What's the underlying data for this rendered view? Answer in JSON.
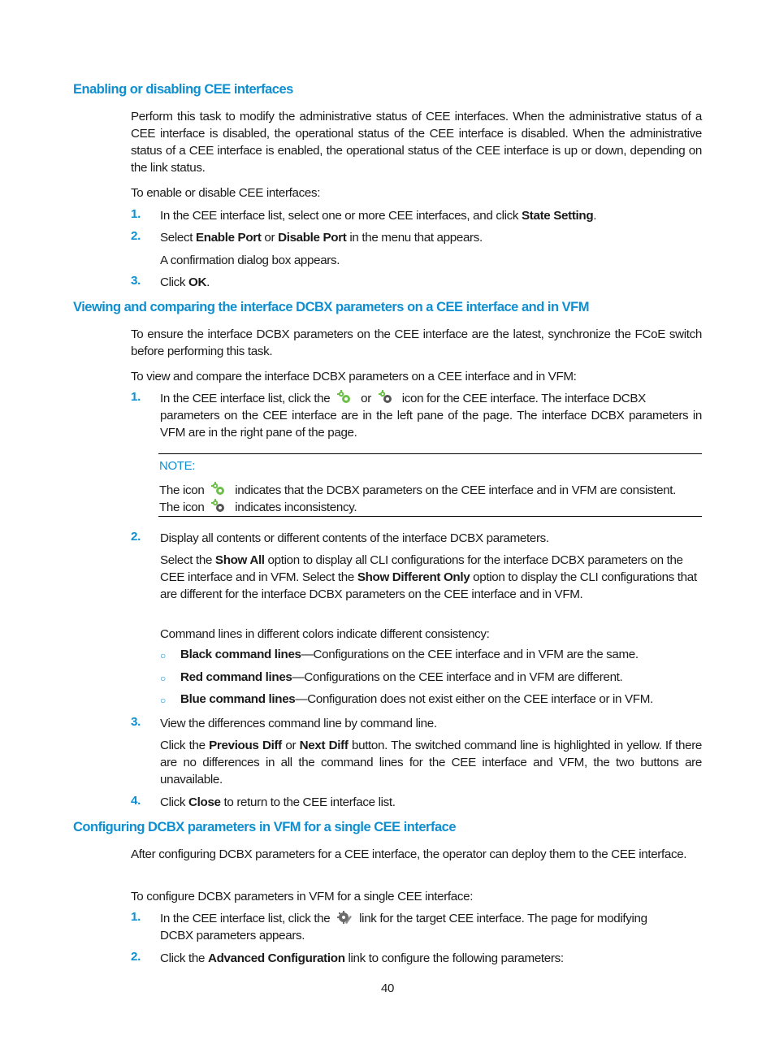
{
  "section1": {
    "heading": "Enabling or disabling CEE interfaces",
    "intro": "Perform this task to modify the administrative status of CEE interfaces. When the administrative status of a CEE interface is disabled, the operational status of the CEE interface is disabled. When the administrative status of a CEE interface is enabled, the operational status of the CEE interface is up or down, depending on the link status.",
    "lead": "To enable or disable CEE interfaces:",
    "steps": [
      {
        "num": "1.",
        "pre": "In the CEE interface list, select one or more CEE interfaces, and click ",
        "bold": "State Setting",
        "post": "."
      },
      {
        "num": "2.",
        "pre": "Select ",
        "bold1": "Enable Port",
        "mid": " or ",
        "bold2": "Disable Port",
        "post": " in the menu that appears.",
        "sub": "A confirmation dialog box appears."
      },
      {
        "num": "3.",
        "pre": "Click ",
        "bold": "OK",
        "post": "."
      }
    ]
  },
  "section2": {
    "heading": "Viewing and comparing the interface DCBX parameters on a CEE interface and in VFM",
    "intro": "To ensure the interface DCBX parameters on the CEE interface are the latest, synchronize the FCoE switch before performing this task.",
    "lead": "To view and compare the interface DCBX parameters on a CEE interface and in VFM:",
    "step1": {
      "num": "1.",
      "pre": "In the CEE interface list, click the",
      "or": "or",
      "post_line1": "icon for the CEE interface. The interface DCBX",
      "rest": "parameters on the CEE interface are in the left pane of the page. The interface DCBX parameters in VFM are in the right pane of the page."
    },
    "note": {
      "label": "NOTE:",
      "line1_pre": "The icon",
      "line1_post": "indicates that the DCBX parameters on the CEE interface and in VFM are consistent.",
      "line2_pre": "The icon",
      "line2_post": "indicates inconsistency."
    },
    "step2": {
      "num": "2.",
      "text": "Display all contents or different contents of the interface DCBX parameters.",
      "p1_a": "Select the ",
      "p1_b": "Show All",
      "p1_c": " option to display all CLI configurations for the interface DCBX parameters on the CEE interface and in VFM. Select the ",
      "p1_d": "Show Different Only",
      "p1_e": " option to display the CLI configurations that are different for the interface DCBX parameters on the CEE interface and in VFM.",
      "p2": "Command lines in different colors indicate different consistency:",
      "bullets": [
        {
          "bold": "Black command lines",
          "text": "—Configurations on the CEE interface and in VFM are the same."
        },
        {
          "bold": "Red command lines",
          "text": "—Configurations on the CEE interface and in VFM are different."
        },
        {
          "bold": "Blue command lines",
          "text": "—Configuration does not exist either on the CEE interface or in VFM."
        }
      ],
      "bullet_glyph": "○"
    },
    "step3": {
      "num": "3.",
      "text": "View the differences command line by command line.",
      "p_a": "Click the ",
      "p_b": "Previous Diff",
      "p_c": " or ",
      "p_d": "Next Diff",
      "p_e": " button. The switched command line is highlighted in yellow. If there are no differences in all the command lines for the CEE interface and VFM, the two buttons are unavailable."
    },
    "step4": {
      "num": "4.",
      "pre": "Click ",
      "bold": "Close",
      "post": " to return to the CEE interface list."
    }
  },
  "section3": {
    "heading": "Configuring DCBX parameters in VFM for a single CEE interface",
    "intro": "After configuring DCBX parameters for a CEE interface, the operator can deploy them to the CEE interface.",
    "lead": "To configure DCBX parameters in VFM for a single CEE interface:",
    "step1": {
      "num": "1.",
      "pre": "In the CEE interface list, click the",
      "post": "link for the target CEE interface. The page for modifying",
      "rest": "DCBX parameters appears."
    },
    "step2": {
      "num": "2.",
      "pre": "Click the ",
      "bold": "Advanced Configuration",
      "post": " link to configure the following parameters:"
    }
  },
  "footer": {
    "page_number": "40"
  },
  "colors": {
    "accent": "#0f8fcf",
    "icon_green": "#6cc04a",
    "icon_gray": "#555555"
  }
}
